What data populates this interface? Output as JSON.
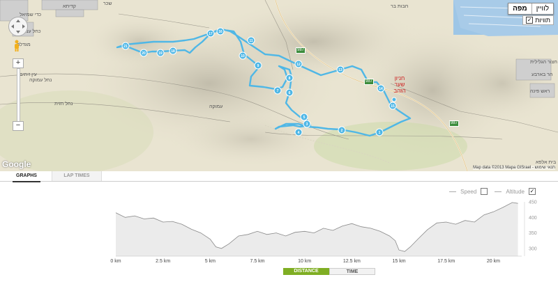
{
  "map": {
    "map_type_buttons": [
      "מפה",
      "לוויין"
    ],
    "active_map_type": "מפה",
    "labels_checkbox": {
      "label": "תוויות",
      "checked": true
    },
    "zoom_in_label": "+",
    "zoom_out_label": "−",
    "logo": "Google",
    "attribution": "Map data ©2013 Mapa GISrael - תנאי שימוש",
    "poi_label": "חניון שער הזהב",
    "road_signs": [
      "987",
      "987",
      "987"
    ],
    "place_labels": [
      "עין זיתים",
      "מגדלה",
      "עמוקה",
      "נחל חזית",
      "קדיתא",
      "נחל עמוקה",
      "חצור הגלילית",
      "כחל עמוד",
      "ראש פינה",
      "שכר",
      "כדי שמיאל",
      "הר בארבע",
      "בית אלפא",
      "חבות בר"
    ],
    "route_color": "#4fb7e6",
    "markers": [
      "1",
      "2",
      "3",
      "4",
      "5",
      "6",
      "7",
      "8",
      "9",
      "10",
      "11",
      "12",
      "13",
      "14",
      "15",
      "16",
      "17",
      "18",
      "19",
      "20",
      "21"
    ]
  },
  "tabs": [
    {
      "label": "GRAPHS",
      "active": true
    },
    {
      "label": "LAP TIMES",
      "active": false
    }
  ],
  "legend": {
    "speed_label": "Speed",
    "speed_checked": false,
    "altitude_label": "Altitude",
    "altitude_checked": true
  },
  "x_axis_toggle": {
    "distance_label": "DISTANCE",
    "time_label": "TIME",
    "active": "DISTANCE"
  },
  "chart_data": {
    "type": "area",
    "title": "",
    "xlabel": "",
    "ylabel": "",
    "x_unit": "km",
    "xlim": [
      0,
      21.5
    ],
    "ylim": [
      275,
      450
    ],
    "x_ticks": [
      0,
      2.5,
      5,
      7.5,
      10,
      12.5,
      15,
      17.5,
      20
    ],
    "x_tick_labels": [
      "0 km",
      "2.5 km",
      "5 km",
      "7.5 km",
      "10 km",
      "12.5 km",
      "15 km",
      "17.5 km",
      "20 km"
    ],
    "y_ticks": [
      300,
      350,
      400,
      450
    ],
    "y_tick_labels": [
      "300",
      "350",
      "400",
      "450"
    ],
    "grid": false,
    "series": [
      {
        "name": "Altitude",
        "x": [
          0,
          0.5,
          1,
          1.5,
          2,
          2.5,
          3,
          3.5,
          4,
          4.5,
          5,
          5.3,
          5.6,
          6,
          6.5,
          7,
          7.5,
          8,
          8.5,
          9,
          9.5,
          10,
          10.5,
          11,
          11.5,
          12,
          12.5,
          13,
          13.5,
          14,
          14.5,
          14.8,
          15,
          15.3,
          15.6,
          16,
          16.5,
          17,
          17.5,
          18,
          18.5,
          19,
          19.5,
          20,
          20.5,
          21,
          21.3
        ],
        "y": [
          415,
          400,
          405,
          395,
          398,
          385,
          387,
          378,
          362,
          350,
          330,
          305,
          300,
          315,
          340,
          345,
          355,
          345,
          350,
          340,
          352,
          355,
          350,
          365,
          358,
          372,
          380,
          370,
          365,
          355,
          340,
          325,
          295,
          290,
          305,
          330,
          360,
          382,
          385,
          378,
          390,
          385,
          408,
          418,
          432,
          448,
          445
        ]
      }
    ]
  }
}
